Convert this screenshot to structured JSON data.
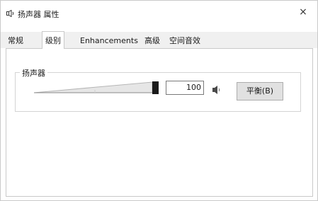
{
  "window": {
    "title": "扬声器 属性",
    "close_glyph": "×",
    "icon": "speaker-icon"
  },
  "tabs": [
    {
      "label": "常规"
    },
    {
      "label": "级别"
    },
    {
      "label": "Enhancements"
    },
    {
      "label": "高级"
    },
    {
      "label": "空间音效"
    }
  ],
  "active_tab": "级别",
  "levels": {
    "group_label": "扬声器",
    "volume_value": "100",
    "volume_level": 1.0,
    "mute_icon": "speaker-volume-icon",
    "balance_label": "平衡(B)"
  }
}
